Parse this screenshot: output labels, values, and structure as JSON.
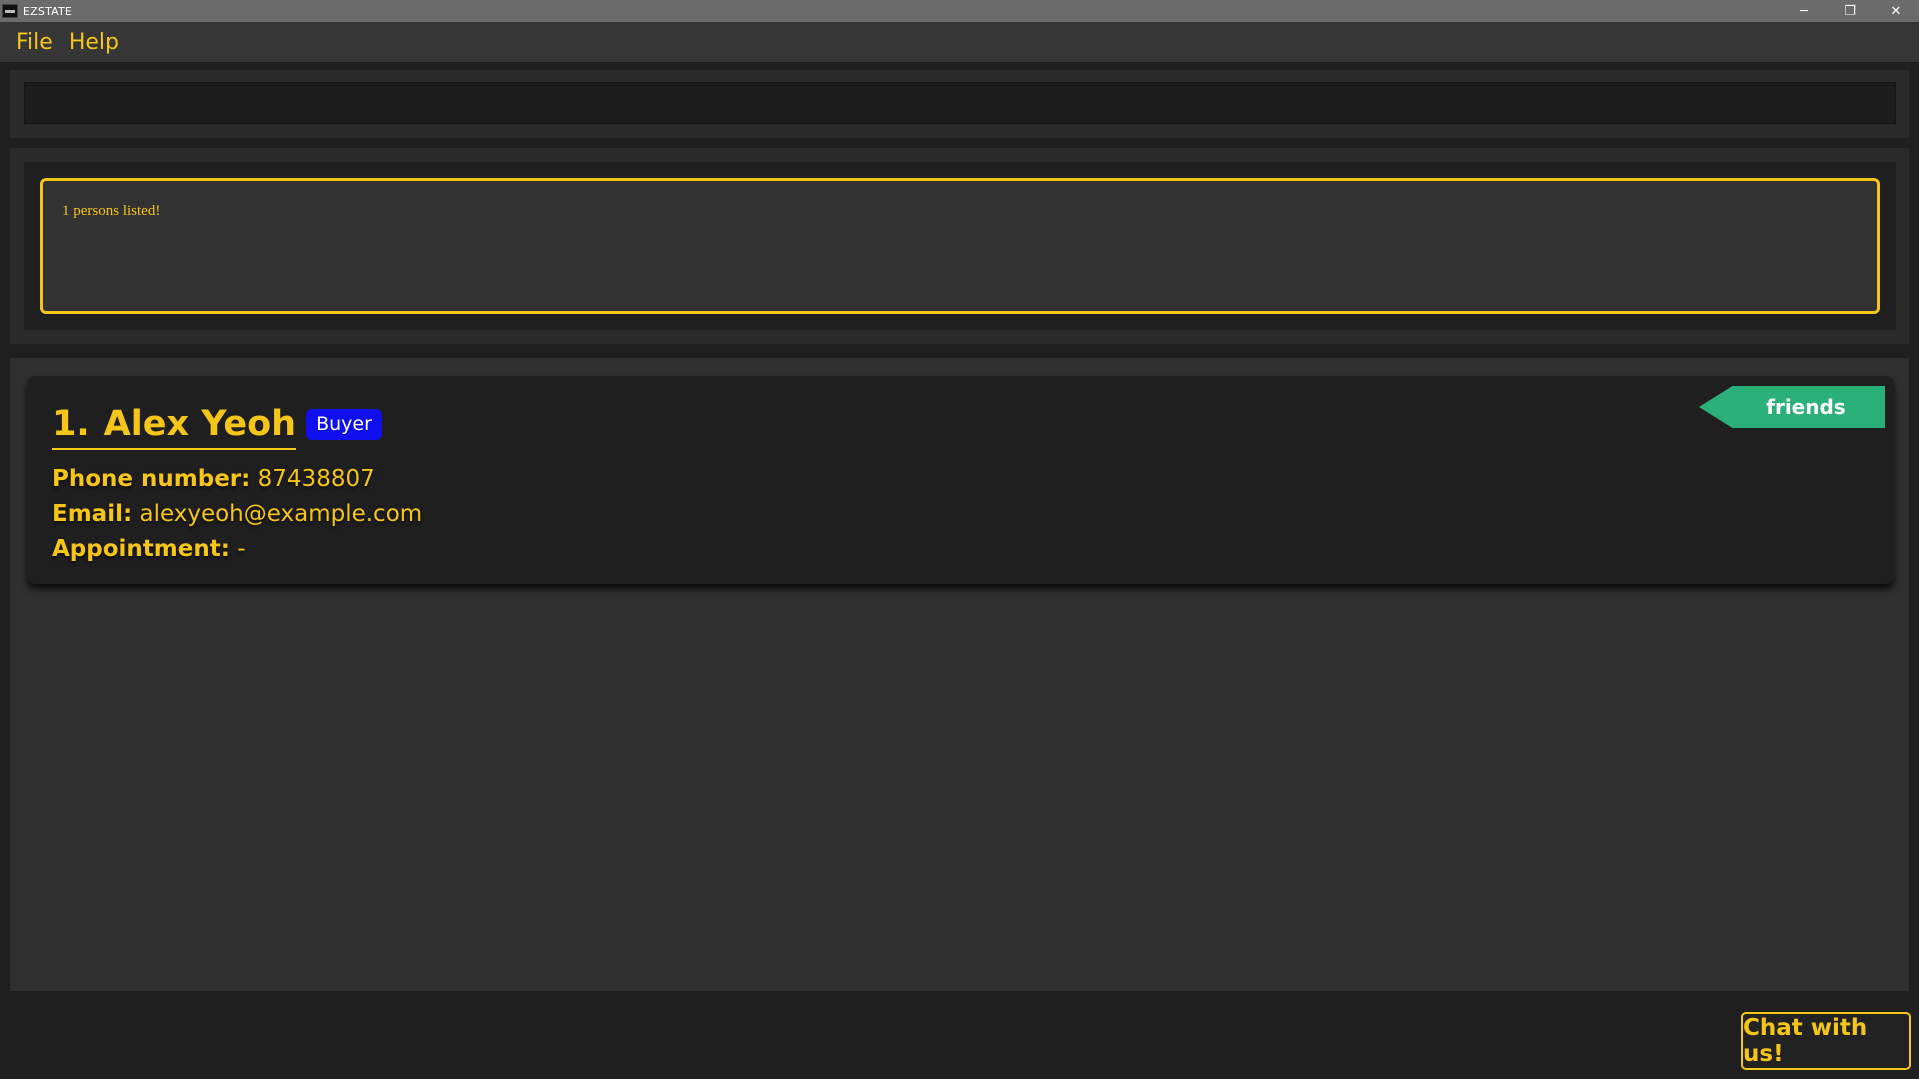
{
  "window": {
    "title": "EZSTATE",
    "minimize_glyph": "─",
    "restore_glyph": "❐",
    "close_glyph": "✕"
  },
  "menu": {
    "file": "File",
    "help": "Help"
  },
  "command": {
    "value": "",
    "placeholder": ""
  },
  "result": {
    "message": "1 persons listed!"
  },
  "persons": [
    {
      "index": "1.",
      "name": "Alex Yeoh",
      "type": "Buyer",
      "phone_label": "Phone number:",
      "phone": "87438807",
      "email_label": "Email:",
      "email": "alexyeoh@example.com",
      "appointment_label": "Appointment:",
      "appointment": "-",
      "tags": [
        "friends"
      ]
    }
  ],
  "chat": {
    "label": "Chat with us!"
  },
  "colors": {
    "accent": "#f5c518",
    "buyer_badge": "#1010ee",
    "tag_friends": "#2bb07a",
    "background": "#1f1f1f"
  }
}
